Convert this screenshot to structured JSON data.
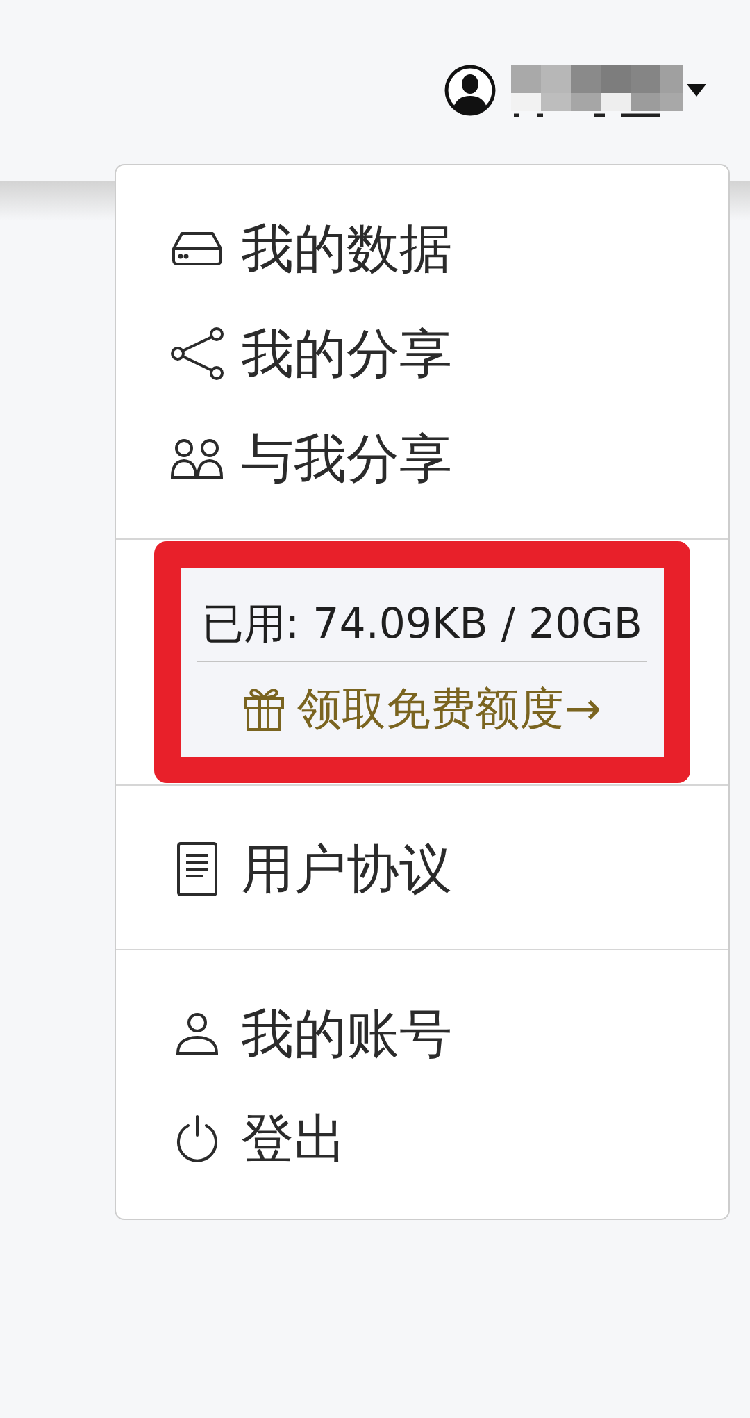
{
  "user_menu": {
    "expanded": true
  },
  "dropdown": {
    "groups": [
      {
        "kind": "links",
        "items": [
          {
            "label": "我的数据"
          },
          {
            "label": "我的分享"
          },
          {
            "label": "与我分享"
          }
        ]
      },
      {
        "kind": "storage",
        "usage": "已用: 74.09KB / 20GB",
        "promo": "领取免费额度→",
        "highlighted": true
      },
      {
        "kind": "links",
        "items": [
          {
            "label": "用户协议"
          }
        ]
      },
      {
        "kind": "links",
        "items": [
          {
            "label": "我的账号"
          },
          {
            "label": "登出"
          }
        ]
      }
    ]
  }
}
